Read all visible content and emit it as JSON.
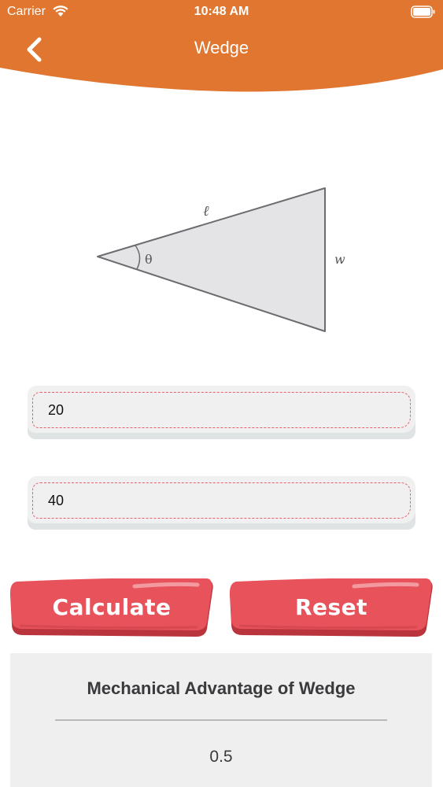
{
  "status_bar": {
    "carrier": "Carrier",
    "time": "10:48 AM"
  },
  "header": {
    "title": "Wedge",
    "back_icon": "chevron-left-icon"
  },
  "diagram": {
    "length_label": "ℓ",
    "angle_label": "θ",
    "width_label": "w"
  },
  "inputs": {
    "length_value": "20",
    "width_value": "40"
  },
  "buttons": {
    "calculate_label": "Calculate",
    "reset_label": "Reset"
  },
  "result": {
    "title": "Mechanical Advantage of Wedge",
    "value": "0.5"
  },
  "colors": {
    "header": "#e0762f",
    "button": "#e8525b",
    "field_dash": "#e8606e",
    "card": "#efeff0"
  }
}
